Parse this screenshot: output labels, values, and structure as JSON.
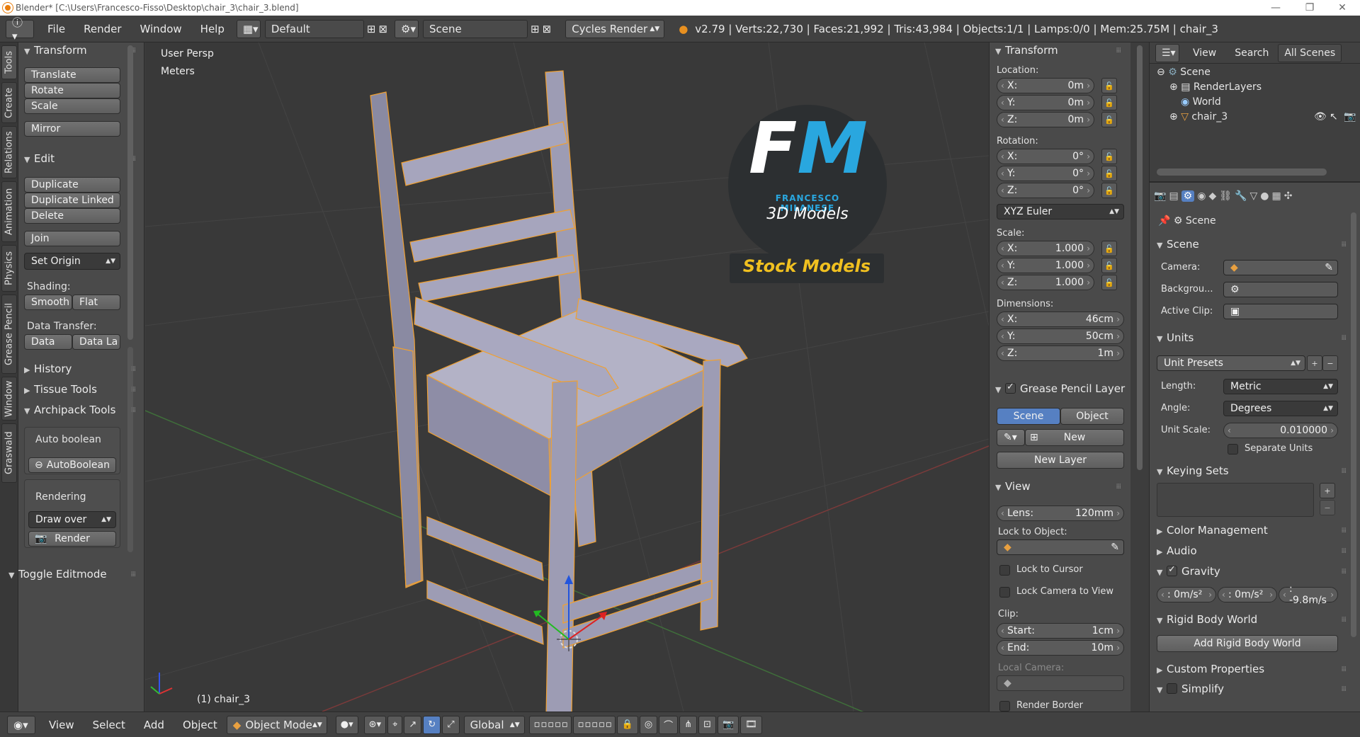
{
  "window": {
    "title": "Blender* [C:\\Users\\Francesco-Fisso\\Desktop\\chair_3\\chair_3.blend]",
    "minimize": "—",
    "maximize": "❐",
    "close": "✕"
  },
  "infobar": {
    "menus": [
      "File",
      "Render",
      "Window",
      "Help"
    ],
    "layout": "Default",
    "scene": "Scene",
    "engine": "Cycles Render",
    "stats": "v2.79 | Verts:22,730 | Faces:21,992 | Tris:43,984 | Objects:1/1 | Lamps:0/0 | Mem:25.75M | chair_3"
  },
  "toolshelf": {
    "tabs": [
      "Tools",
      "Create",
      "Relations",
      "Animation",
      "Physics",
      "Grease Pencil",
      "Window",
      "Graswald"
    ],
    "transform": {
      "title": "Transform",
      "buttons": [
        "Translate",
        "Rotate",
        "Scale",
        "Mirror"
      ]
    },
    "edit": {
      "title": "Edit",
      "buttons": [
        "Duplicate",
        "Duplicate Linked",
        "Delete",
        "Join"
      ],
      "set_origin": "Set Origin",
      "shading_label": "Shading:",
      "smooth": "Smooth",
      "flat": "Flat",
      "data_transfer_label": "Data Transfer:",
      "data": "Data",
      "data_la": "Data La"
    },
    "history": "History",
    "tissue": "Tissue Tools",
    "archipack": "Archipack Tools",
    "auto_boolean": "Auto boolean",
    "autoboolean_btn": "AutoBoolean",
    "rendering": "Rendering",
    "draw_over": "Draw over",
    "render": "Render",
    "toggle_editmode": "Toggle Editmode"
  },
  "viewport": {
    "view_name": "User Persp",
    "units": "Meters",
    "object_label": "(1) chair_3",
    "watermark": {
      "initials_f": "F",
      "initials_m": "M",
      "line1": "FRANCESCO MILANESE",
      "line2": "3D Models",
      "banner": "Stock Models"
    }
  },
  "npanel": {
    "transform": "Transform",
    "location_label": "Location:",
    "location": [
      "0m",
      "0m",
      "0m"
    ],
    "rotation_label": "Rotation:",
    "rotation": [
      "0°",
      "0°",
      "0°"
    ],
    "rotation_mode": "XYZ Euler",
    "scale_label": "Scale:",
    "scale": [
      "1.000",
      "1.000",
      "1.000"
    ],
    "dimensions_label": "Dimensions:",
    "dimensions": [
      "46cm",
      "50cm",
      "1m"
    ],
    "axes": [
      "X:",
      "Y:",
      "Z:"
    ],
    "grease_pencil": "Grease Pencil Layer",
    "gp_scene": "Scene",
    "gp_object": "Object",
    "gp_new": "New",
    "gp_new_layer": "New Layer",
    "view": "View",
    "lens_label": "Lens:",
    "lens": "120mm",
    "lock_to_object": "Lock to Object:",
    "lock_to_cursor": "Lock to Cursor",
    "lock_camera": "Lock Camera to View",
    "clip_label": "Clip:",
    "clip_start_label": "Start:",
    "clip_start": "1cm",
    "clip_end_label": "End:",
    "clip_end": "10m",
    "local_camera": "Local Camera:",
    "render_border": "Render Border"
  },
  "outliner": {
    "view": "View",
    "search": "Search",
    "all_scenes": "All Scenes",
    "items": [
      "Scene",
      "RenderLayers",
      "World",
      "chair_3"
    ]
  },
  "properties": {
    "context": "Scene",
    "scene_panel": "Scene",
    "camera_label": "Camera:",
    "background_label": "Backgrou...",
    "active_clip_label": "Active Clip:",
    "units_panel": "Units",
    "unit_presets": "Unit Presets",
    "length_label": "Length:",
    "length": "Metric",
    "angle_label": "Angle:",
    "angle": "Degrees",
    "unit_scale_label": "Unit Scale:",
    "unit_scale": "0.010000",
    "separate_units": "Separate Units",
    "keying_sets": "Keying Sets",
    "color_management": "Color Management",
    "audio": "Audio",
    "gravity": "Gravity",
    "gravity_values": [
      ": 0m/s²",
      ": 0m/s²",
      ": -9.8m/s"
    ],
    "rigid_body_world": "Rigid Body World",
    "add_rigid_body_world": "Add Rigid Body World",
    "custom_properties": "Custom Properties",
    "simplify": "Simplify"
  },
  "statusbar": {
    "menus": [
      "View",
      "Select",
      "Add",
      "Object"
    ],
    "mode": "Object Mode",
    "orientation": "Global"
  },
  "colors": {
    "accent_blue": "#5680c2",
    "selection_outline": "#f0a030",
    "watermark_blue": "#29a7df",
    "watermark_gold": "#f0c020"
  }
}
